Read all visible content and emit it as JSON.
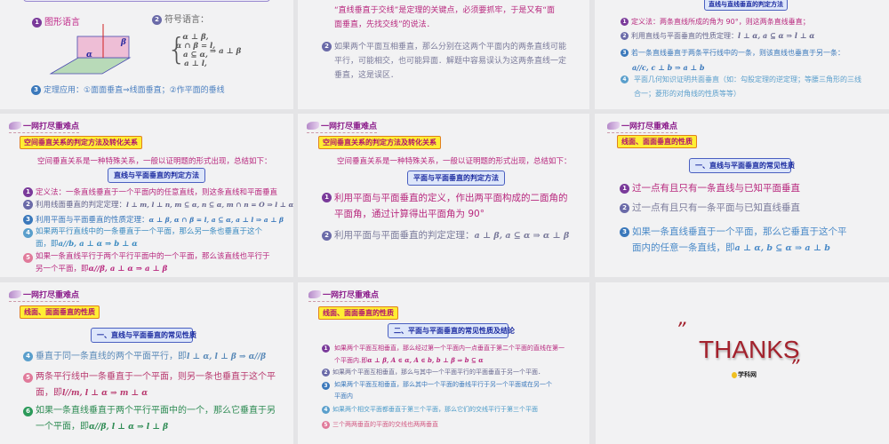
{
  "slides": {
    "s1": {
      "label1": "图形语言",
      "label2": "符号语言：",
      "alpha": "α",
      "beta": "β",
      "system": [
        "α ⊥ β,",
        "α ∩ β = l,",
        "a ⊆ α,",
        "a ⊥ l,"
      ],
      "conclusion": "⇒ a ⊥ β",
      "application": "定理应用：①面面垂直⇒线面垂直；②作平面的垂线"
    },
    "s2": {
      "item1_lines": [
        "“直线垂直于交线”是定理的关键点，必须要抓牢，于是又有“面",
        "面垂直，先找交线”的说法．"
      ],
      "item2": "如果两个平面互相垂直，那么分别在这两个平面内的两条直线可能平行，可能相交，也可能异面．解题中容易误认为这两条直线一定垂直，这是误区．"
    },
    "s3": {
      "box": "直线与直线垂直的判定方法",
      "items": [
        {
          "text": "定义法：两条直线所成的角为 90°，则这两条直线垂直；",
          "math": ""
        },
        {
          "text": "利用直线与平面垂直的性质定理：",
          "math": "l ⊥ α, a ⊆ α ⇒ l ⊥ α"
        },
        {
          "text": "若一条直线垂直于两条平行线中的一条，则该直线也垂直于另一条：",
          "math": "a//c, c ⊥ b ⇒ a ⊥ b"
        },
        {
          "text": "平面几何知识证明共面垂直（如：勾股定理的逆定理；等腰三角形的三线合一；菱形的对角线的性质等等）",
          "math": ""
        }
      ]
    },
    "s4": {
      "logo": "一网打尽重难点",
      "tag": "空间垂直关系的判定方法及转化关系",
      "intro": "空间垂直关系是一种特殊关系，一般以证明题的形式出现，总结如下：",
      "box": "直线与平面垂直的判定方法",
      "items": [
        {
          "text": "定义法：一条直线垂直于一个平面内的任意直线，则这条直线和平面垂直",
          "math": ""
        },
        {
          "text": "利用线面垂直的判定定理：",
          "math": "l ⊥ m, l ⊥ n, m ⊆ α, n ⊆ α, m ∩ n = O ⇒ l ⊥ α"
        },
        {
          "text": "利用平面与平面垂直的性质定理：",
          "math": "α ⊥ β, α ∩ β = l, a ⊆ α, a ⊥ l ⇒ a ⊥ β"
        },
        {
          "text": "如果两平行直线中的一条垂直于一个平面，那么另一条也垂直于这个面，即",
          "math": "a//b, a ⊥ α ⇒ b ⊥ α"
        },
        {
          "text": "如果一条直线平行于两个平行平面中的一个平面，那么该直线也平行于另一个平面，即",
          "math": "α//β, a ⊥ α ⇒ a ⊥ β"
        }
      ]
    },
    "s5": {
      "logo": "一网打尽重难点",
      "tag": "空间垂直关系的判定方法及转化关系",
      "intro": "空间垂直关系是一种特殊关系，一般以证明题的形式出现，总结如下：",
      "box": "平面与平面垂直的判定方法",
      "items": [
        {
          "text": "利用平面与平面垂直的定义，作出两平面构成的二面角的平面角，通过计算得出平面角为 90°",
          "math": ""
        },
        {
          "text": "利用平面与平面垂直的判定定理：",
          "math": "a ⊥ β, a ⊆ α ⇒ α ⊥ β"
        }
      ]
    },
    "s6": {
      "logo": "一网打尽重难点",
      "tag": "线面、面面垂直的性质",
      "box": "一、直线与平面垂直的常见性质",
      "items": [
        {
          "text": "过一点有且只有一条直线与已知平面垂直",
          "math": ""
        },
        {
          "text": "过一点有且只有一条平面与已知直线垂直",
          "math": ""
        },
        {
          "text": "如果一条直线垂直于一个平面，那么它垂直于这个平面内的任意一条直线，即",
          "math": "a ⊥ α, b ⊆ α ⇒ a ⊥ b"
        }
      ]
    },
    "s7": {
      "logo": "一网打尽重难点",
      "tag": "线面、面面垂直的性质",
      "box": "一、直线与平面垂直的常见性质",
      "items": [
        {
          "text": "垂直于同一条直线的两个平面平行，即",
          "math": "l ⊥ α, l ⊥ β ⇒ α//β"
        },
        {
          "text": "两条平行线中一条垂直于一个平面，则另一条也垂直于这个平面，即",
          "math": "l//m, l ⊥ α ⇒ m ⊥ α"
        },
        {
          "text": "如果一条直线垂直于两个平行平面中的一个，那么它垂直于另一个平面，即",
          "math": "α//β, l ⊥ α ⇒ l ⊥ β"
        }
      ]
    },
    "s8": {
      "logo": "一网打尽重难点",
      "tag": "线面、面面垂直的性质",
      "box": "二、平面与平面垂直的常见性质及结论",
      "items": [
        {
          "text": "如果两个平面互相垂直，那么经过第一个平面内一点垂直于第二个平面的直线在第一个平面内.即",
          "math": "α ⊥ β, A ∈ α, A ∈ b, b ⊥ β ⇒ b ⊆ α"
        },
        {
          "text": "如果两个平面互相垂直，那么与其中一个平面平行的平面垂直于另一个平面．",
          "math": ""
        },
        {
          "text": "如果两个平面互相垂直，那么其中一个平面的垂线平行于另一个平面或在另一个平面内",
          "math": ""
        },
        {
          "text": "如果两个相交平面都垂直于第三个平面，那么它们的交线平行于第三个平面",
          "math": ""
        },
        {
          "text": "三个两两垂直的平面的交线也两两垂直",
          "math": ""
        }
      ]
    },
    "s9": {
      "thanks": "THANKS",
      "open_quote": "”",
      "close_quote": "”",
      "logo": "学科网"
    }
  },
  "colors": {
    "magenta": "#b8287e",
    "slate": "#66668e",
    "blue": "#3a78bb",
    "lightblue": "#5a9fcc",
    "pink": "#d25a82",
    "green": "#2c8a52",
    "thanks": "#a3222d"
  }
}
